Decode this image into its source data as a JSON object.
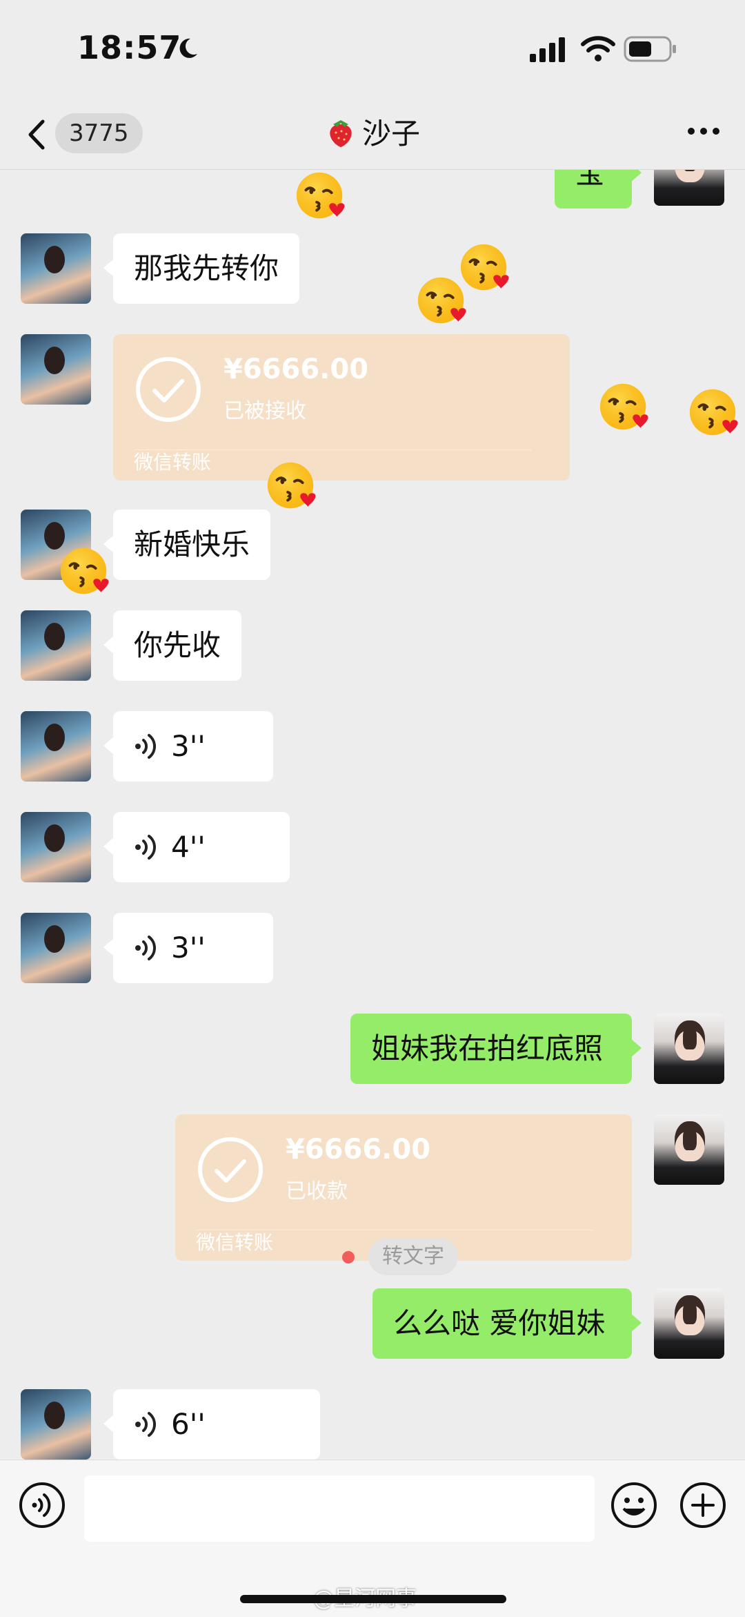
{
  "status_bar": {
    "time": "18:57"
  },
  "header": {
    "back_count": "3775",
    "title": "沙子"
  },
  "messages": {
    "top_partial": "宝",
    "m1": "那我先转你",
    "transfer1": {
      "amount": "¥6666.00",
      "status": "已被接收",
      "footer": "微信转账"
    },
    "m2": "新婚快乐",
    "m3": "你先收",
    "v1": "3''",
    "v2": "4''",
    "v3": "3''",
    "r1": "姐妹我在拍红底照",
    "transfer2": {
      "amount": "¥6666.00",
      "status": "已收款",
      "footer": "微信转账"
    },
    "r2": "么么哒 爱你姐妹",
    "v4": "6''",
    "to_text": "转文字"
  },
  "watermark": "@星河网事",
  "colors": {
    "background": "#ededed",
    "sent_bubble": "#95ec69",
    "received_bubble": "#ffffff",
    "transfer": "#f5dfc6",
    "unread_dot": "#f45b5b"
  },
  "icons": [
    "moon-icon",
    "signal-icon",
    "wifi-icon",
    "battery-icon",
    "back-chevron-icon",
    "strawberry-icon",
    "more-icon",
    "voice-wave-icon",
    "check-circle-icon",
    "kiss-emoji-icon",
    "voice-input-icon",
    "emoji-icon",
    "plus-icon"
  ]
}
